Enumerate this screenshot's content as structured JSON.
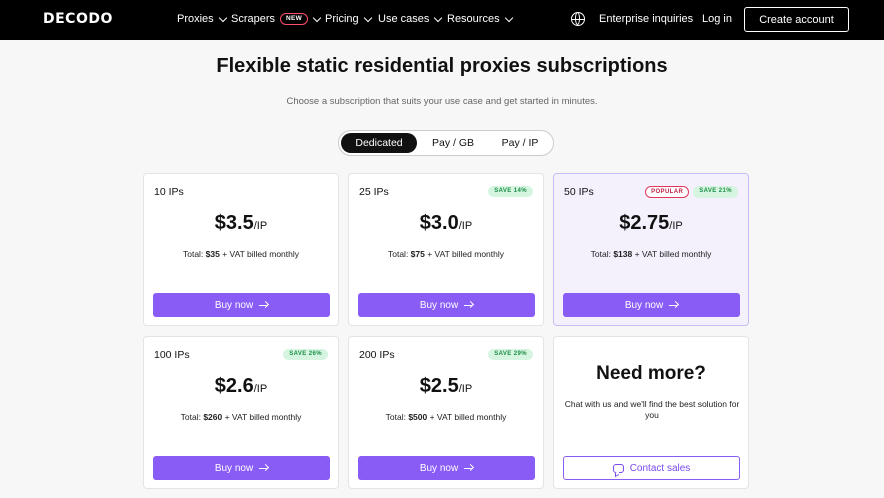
{
  "nav": {
    "logo": "DECODO",
    "items": [
      {
        "label": "Proxies",
        "badge": ""
      },
      {
        "label": "Scrapers",
        "badge": "NEW"
      },
      {
        "label": "Pricing",
        "badge": ""
      },
      {
        "label": "Use cases",
        "badge": ""
      },
      {
        "label": "Resources",
        "badge": ""
      }
    ],
    "enterprise": "Enterprise inquiries",
    "login": "Log in",
    "create_account": "Create account",
    "globe_icon": "globe-icon"
  },
  "header": {
    "title": "Flexible static residential proxies subscriptions",
    "subtitle": "Choose a subscription that suits your use case and get started in minutes."
  },
  "toggle": {
    "options": [
      "Dedicated",
      "Pay / GB",
      "Pay / IP"
    ],
    "selected": "Dedicated"
  },
  "plans": [
    {
      "ips": "10 IPs",
      "save": "",
      "popular": "",
      "price": "$3.5",
      "unit": "/IP",
      "total_prefix": "Total: ",
      "total_amount": "$35",
      "total_suffix": " + VAT billed monthly",
      "button": "Buy now"
    },
    {
      "ips": "25 IPs",
      "save": "SAVE 14%",
      "popular": "",
      "price": "$3.0",
      "unit": "/IP",
      "total_prefix": "Total: ",
      "total_amount": "$75",
      "total_suffix": " + VAT billed monthly",
      "button": "Buy now"
    },
    {
      "ips": "50 IPs",
      "save": "SAVE 21%",
      "popular": "POPULAR",
      "price": "$2.75",
      "unit": "/IP",
      "total_prefix": "Total: ",
      "total_amount": "$138",
      "total_suffix": " + VAT billed monthly",
      "button": "Buy now"
    },
    {
      "ips": "100 IPs",
      "save": "SAVE 26%",
      "popular": "",
      "price": "$2.6",
      "unit": "/IP",
      "total_prefix": "Total: ",
      "total_amount": "$260",
      "total_suffix": " + VAT billed monthly",
      "button": "Buy now"
    },
    {
      "ips": "200 IPs",
      "save": "SAVE 29%",
      "popular": "",
      "price": "$2.5",
      "unit": "/IP",
      "total_prefix": "Total: ",
      "total_amount": "$500",
      "total_suffix": " + VAT billed monthly",
      "button": "Buy now"
    }
  ],
  "need_more": {
    "title": "Need more?",
    "text": "Chat with us and we'll find the best solution for you",
    "button": "Contact sales"
  },
  "colors": {
    "accent": "#8a5cf6",
    "nav_bg": "#000000",
    "popular_card_bg": "#f4f1fd",
    "save_badge_bg": "#d6f5e1",
    "save_badge_text": "#1b8e45",
    "popular_badge_border": "#e0365a"
  }
}
